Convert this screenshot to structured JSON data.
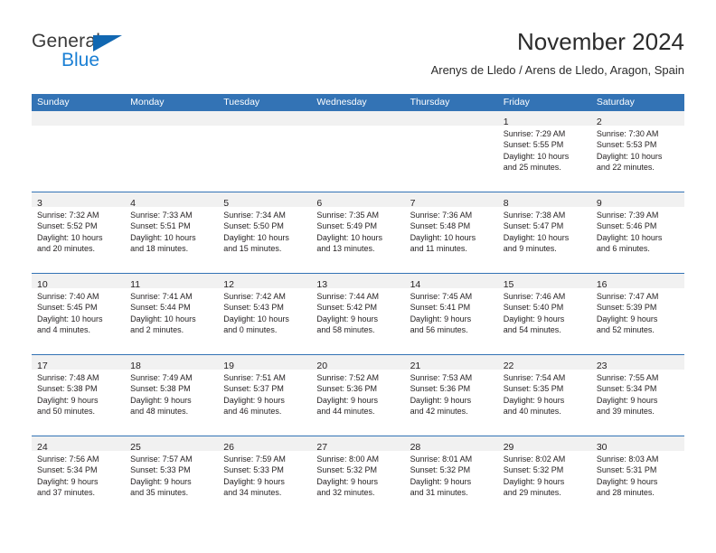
{
  "brand": {
    "name_dark": "General",
    "name_blue": "Blue",
    "accent_blue": "#1a7fd4",
    "triangle_blue": "#1167b1"
  },
  "header": {
    "title": "November 2024",
    "subtitle": "Arenys de Lledo / Arens de Lledo, Aragon, Spain"
  },
  "theme": {
    "header_row_blue": "#3373b5",
    "daynum_band_gray": "#f1f1f1",
    "text_color": "#231f20"
  },
  "weekdays": [
    "Sunday",
    "Monday",
    "Tuesday",
    "Wednesday",
    "Thursday",
    "Friday",
    "Saturday"
  ],
  "weeks": [
    [
      {
        "day": "",
        "sunrise": "",
        "sunset": "",
        "daylight1": "",
        "daylight2": ""
      },
      {
        "day": "",
        "sunrise": "",
        "sunset": "",
        "daylight1": "",
        "daylight2": ""
      },
      {
        "day": "",
        "sunrise": "",
        "sunset": "",
        "daylight1": "",
        "daylight2": ""
      },
      {
        "day": "",
        "sunrise": "",
        "sunset": "",
        "daylight1": "",
        "daylight2": ""
      },
      {
        "day": "",
        "sunrise": "",
        "sunset": "",
        "daylight1": "",
        "daylight2": ""
      },
      {
        "day": "1",
        "sunrise": "Sunrise: 7:29 AM",
        "sunset": "Sunset: 5:55 PM",
        "daylight1": "Daylight: 10 hours",
        "daylight2": "and 25 minutes."
      },
      {
        "day": "2",
        "sunrise": "Sunrise: 7:30 AM",
        "sunset": "Sunset: 5:53 PM",
        "daylight1": "Daylight: 10 hours",
        "daylight2": "and 22 minutes."
      }
    ],
    [
      {
        "day": "3",
        "sunrise": "Sunrise: 7:32 AM",
        "sunset": "Sunset: 5:52 PM",
        "daylight1": "Daylight: 10 hours",
        "daylight2": "and 20 minutes."
      },
      {
        "day": "4",
        "sunrise": "Sunrise: 7:33 AM",
        "sunset": "Sunset: 5:51 PM",
        "daylight1": "Daylight: 10 hours",
        "daylight2": "and 18 minutes."
      },
      {
        "day": "5",
        "sunrise": "Sunrise: 7:34 AM",
        "sunset": "Sunset: 5:50 PM",
        "daylight1": "Daylight: 10 hours",
        "daylight2": "and 15 minutes."
      },
      {
        "day": "6",
        "sunrise": "Sunrise: 7:35 AM",
        "sunset": "Sunset: 5:49 PM",
        "daylight1": "Daylight: 10 hours",
        "daylight2": "and 13 minutes."
      },
      {
        "day": "7",
        "sunrise": "Sunrise: 7:36 AM",
        "sunset": "Sunset: 5:48 PM",
        "daylight1": "Daylight: 10 hours",
        "daylight2": "and 11 minutes."
      },
      {
        "day": "8",
        "sunrise": "Sunrise: 7:38 AM",
        "sunset": "Sunset: 5:47 PM",
        "daylight1": "Daylight: 10 hours",
        "daylight2": "and 9 minutes."
      },
      {
        "day": "9",
        "sunrise": "Sunrise: 7:39 AM",
        "sunset": "Sunset: 5:46 PM",
        "daylight1": "Daylight: 10 hours",
        "daylight2": "and 6 minutes."
      }
    ],
    [
      {
        "day": "10",
        "sunrise": "Sunrise: 7:40 AM",
        "sunset": "Sunset: 5:45 PM",
        "daylight1": "Daylight: 10 hours",
        "daylight2": "and 4 minutes."
      },
      {
        "day": "11",
        "sunrise": "Sunrise: 7:41 AM",
        "sunset": "Sunset: 5:44 PM",
        "daylight1": "Daylight: 10 hours",
        "daylight2": "and 2 minutes."
      },
      {
        "day": "12",
        "sunrise": "Sunrise: 7:42 AM",
        "sunset": "Sunset: 5:43 PM",
        "daylight1": "Daylight: 10 hours",
        "daylight2": "and 0 minutes."
      },
      {
        "day": "13",
        "sunrise": "Sunrise: 7:44 AM",
        "sunset": "Sunset: 5:42 PM",
        "daylight1": "Daylight: 9 hours",
        "daylight2": "and 58 minutes."
      },
      {
        "day": "14",
        "sunrise": "Sunrise: 7:45 AM",
        "sunset": "Sunset: 5:41 PM",
        "daylight1": "Daylight: 9 hours",
        "daylight2": "and 56 minutes."
      },
      {
        "day": "15",
        "sunrise": "Sunrise: 7:46 AM",
        "sunset": "Sunset: 5:40 PM",
        "daylight1": "Daylight: 9 hours",
        "daylight2": "and 54 minutes."
      },
      {
        "day": "16",
        "sunrise": "Sunrise: 7:47 AM",
        "sunset": "Sunset: 5:39 PM",
        "daylight1": "Daylight: 9 hours",
        "daylight2": "and 52 minutes."
      }
    ],
    [
      {
        "day": "17",
        "sunrise": "Sunrise: 7:48 AM",
        "sunset": "Sunset: 5:38 PM",
        "daylight1": "Daylight: 9 hours",
        "daylight2": "and 50 minutes."
      },
      {
        "day": "18",
        "sunrise": "Sunrise: 7:49 AM",
        "sunset": "Sunset: 5:38 PM",
        "daylight1": "Daylight: 9 hours",
        "daylight2": "and 48 minutes."
      },
      {
        "day": "19",
        "sunrise": "Sunrise: 7:51 AM",
        "sunset": "Sunset: 5:37 PM",
        "daylight1": "Daylight: 9 hours",
        "daylight2": "and 46 minutes."
      },
      {
        "day": "20",
        "sunrise": "Sunrise: 7:52 AM",
        "sunset": "Sunset: 5:36 PM",
        "daylight1": "Daylight: 9 hours",
        "daylight2": "and 44 minutes."
      },
      {
        "day": "21",
        "sunrise": "Sunrise: 7:53 AM",
        "sunset": "Sunset: 5:36 PM",
        "daylight1": "Daylight: 9 hours",
        "daylight2": "and 42 minutes."
      },
      {
        "day": "22",
        "sunrise": "Sunrise: 7:54 AM",
        "sunset": "Sunset: 5:35 PM",
        "daylight1": "Daylight: 9 hours",
        "daylight2": "and 40 minutes."
      },
      {
        "day": "23",
        "sunrise": "Sunrise: 7:55 AM",
        "sunset": "Sunset: 5:34 PM",
        "daylight1": "Daylight: 9 hours",
        "daylight2": "and 39 minutes."
      }
    ],
    [
      {
        "day": "24",
        "sunrise": "Sunrise: 7:56 AM",
        "sunset": "Sunset: 5:34 PM",
        "daylight1": "Daylight: 9 hours",
        "daylight2": "and 37 minutes."
      },
      {
        "day": "25",
        "sunrise": "Sunrise: 7:57 AM",
        "sunset": "Sunset: 5:33 PM",
        "daylight1": "Daylight: 9 hours",
        "daylight2": "and 35 minutes."
      },
      {
        "day": "26",
        "sunrise": "Sunrise: 7:59 AM",
        "sunset": "Sunset: 5:33 PM",
        "daylight1": "Daylight: 9 hours",
        "daylight2": "and 34 minutes."
      },
      {
        "day": "27",
        "sunrise": "Sunrise: 8:00 AM",
        "sunset": "Sunset: 5:32 PM",
        "daylight1": "Daylight: 9 hours",
        "daylight2": "and 32 minutes."
      },
      {
        "day": "28",
        "sunrise": "Sunrise: 8:01 AM",
        "sunset": "Sunset: 5:32 PM",
        "daylight1": "Daylight: 9 hours",
        "daylight2": "and 31 minutes."
      },
      {
        "day": "29",
        "sunrise": "Sunrise: 8:02 AM",
        "sunset": "Sunset: 5:32 PM",
        "daylight1": "Daylight: 9 hours",
        "daylight2": "and 29 minutes."
      },
      {
        "day": "30",
        "sunrise": "Sunrise: 8:03 AM",
        "sunset": "Sunset: 5:31 PM",
        "daylight1": "Daylight: 9 hours",
        "daylight2": "and 28 minutes."
      }
    ]
  ]
}
